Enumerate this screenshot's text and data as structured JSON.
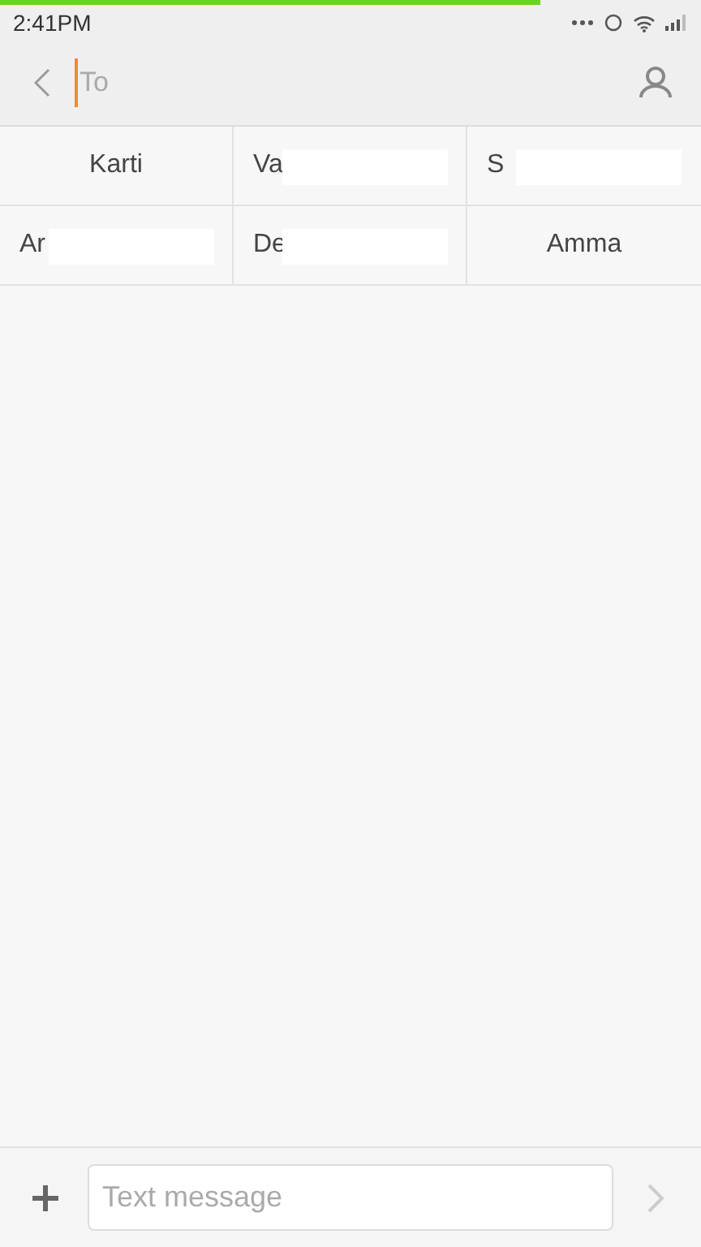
{
  "progress": {
    "level": 0.77
  },
  "status_bar": {
    "time": "2:41PM"
  },
  "header": {
    "placeholder": "To"
  },
  "contacts": [
    {
      "name": "Karti",
      "redacted": false
    },
    {
      "name": "Va",
      "redacted": true
    },
    {
      "name": "S",
      "redacted": true
    },
    {
      "name": "Ar",
      "redacted": true
    },
    {
      "name": "De",
      "redacted": true
    },
    {
      "name": "Amma",
      "redacted": false
    }
  ],
  "composer": {
    "placeholder": "Text message"
  }
}
